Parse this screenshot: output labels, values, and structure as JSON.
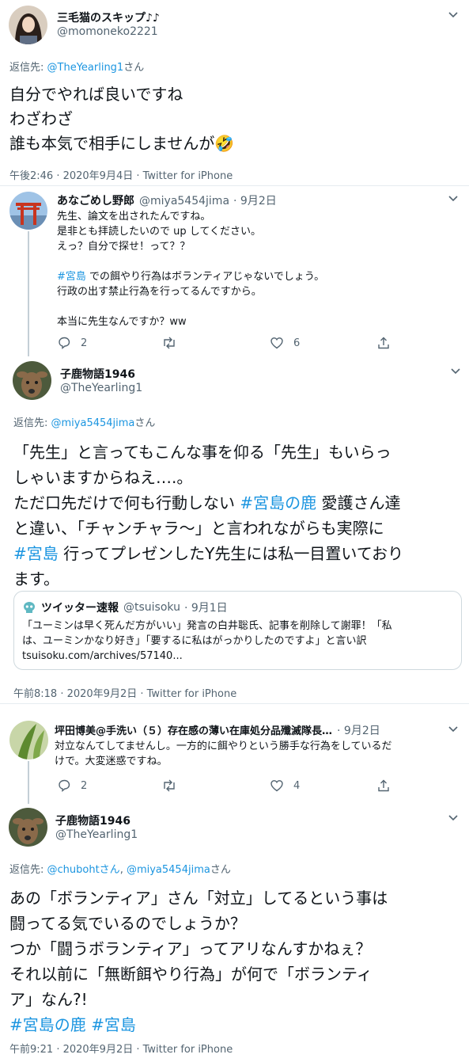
{
  "tweet1": {
    "display_name": "三毛猫のスキップ♪♪",
    "handle": "@momoneko2221",
    "reply_prefix": "返信先: ",
    "reply_to": "@TheYearling1",
    "reply_suffix": "さん",
    "lines": [
      "自分でやれば良いですね",
      "わざわざ",
      "誰も本気で相手にしませんが🤣"
    ],
    "timestamp": "午後2:46 · 2020年9月4日 · Twitter for iPhone"
  },
  "tweet2": {
    "display_name": "あなごめし野郎",
    "handle": "@miya5454jima",
    "date": "· 9月2日",
    "lines": [
      "先生、論文を出されたんですね。",
      "是非とも拝読したいので up してください。",
      "えっ？自分で探せ！って？？",
      "",
      "#宮島 での餌やり行為はボランティアじゃないでしょう。",
      "行政の出す禁止行為を行ってるんですから。",
      "",
      "本当に先生なんですか？ww"
    ],
    "hashtag": "#宮島",
    "reply_count": "2",
    "like_count": "6"
  },
  "tweet3": {
    "display_name": "子鹿物語1946",
    "handle": "@TheYearling1",
    "reply_prefix": "返信先: ",
    "reply_to": "@miya5454jima",
    "reply_suffix": "さん",
    "line1": "「先生」と言ってもこんな事を仰る「先生」もいらっ",
    "line2": "しゃいますからねえ….。",
    "line3a": "ただ口先だけで何も行動しない ",
    "line3tag": "#宮島の鹿",
    "line3b": "  愛護さん達",
    "line4": "と違い、「チャンチャラ〜」と言われながらも実際に",
    "line5tag": "#宮島",
    "line5b": " 行ってプレゼンしたY先生には私一目置いており",
    "line6": "ます。",
    "card": {
      "source_name": "ツイッター速報",
      "source_handle": "@tsuisoku",
      "source_date": "· 9月1日",
      "text1": "「ユーミンは早く死んだ方がいい」発言の白井聡氏、記事を削除して謝罪！「私",
      "text2": "は、ユーミンかなり好き」「要するに私はがっかりしたのですよ」と言い訳",
      "url": "tsuisoku.com/archives/57140..."
    },
    "timestamp": "午前8:18 · 2020年9月2日 · Twitter for iPhone"
  },
  "tweet4": {
    "display_name": "坪田博美@手洗い（５）存在感の薄い在庫処分品殲滅隊長…",
    "date": "· 9月2日",
    "line1": "対立なんてしてませんし。一方的に餌やりという勝手な行為をしているだ",
    "line2": "けで。大変迷惑ですね。",
    "reply_count": "2",
    "like_count": "4"
  },
  "tweet5": {
    "display_name": "子鹿物語1946",
    "handle": "@TheYearling1",
    "reply_prefix": "返信先: ",
    "reply_to1": "@chubohtさん",
    "reply_sep": ", ",
    "reply_to2": "@miya5454jima",
    "reply_suffix": "さん",
    "lines": [
      "あの「ボランティア」さん「対立」してるという事は",
      "闘ってる気でいるのでしょうか？",
      "つか「闘うボランティア」ってアリなんすかねぇ？",
      "それ以前に「無断餌やり行為」が何で「ボランティ",
      "ア」なん?!"
    ],
    "hashtags": "#宮島の鹿 #宮島",
    "timestamp": "午前9:21 · 2020年9月2日 · Twitter for iPhone"
  },
  "colors": {
    "link": "#1b95e0",
    "secondary": "#536471",
    "text": "#0f1419",
    "thread": "#c4cfd6"
  },
  "icons": [
    "chevron-down-icon",
    "reply-icon",
    "retweet-icon",
    "like-icon",
    "share-icon",
    "emoji-rofl-icon"
  ]
}
